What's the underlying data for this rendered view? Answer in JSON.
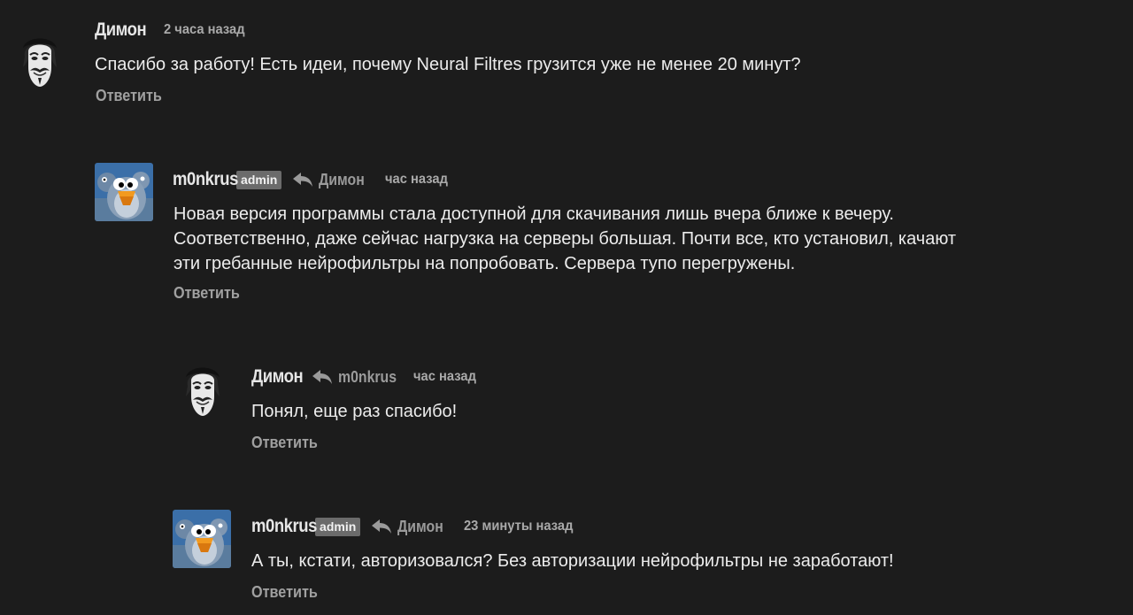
{
  "colors": {
    "background": "#1c1c1c",
    "text": "#ececec",
    "muted": "#a0a0a0",
    "badge_bg": "#6b6b6b"
  },
  "comments": [
    {
      "author": "Димон",
      "avatar_icon": "guy-fawkes-mask-avatar",
      "time": "2 часа назад",
      "text": "Спасибо за работу! Есть идеи, почему Neural Filtres грузится уже не менее 20 минут?",
      "reply_label": "Ответить"
    },
    {
      "author": "m0nkrus",
      "badge": "admin",
      "avatar_icon": "bird-avatar",
      "reply_to": "Димон",
      "time": "час назад",
      "text_lines": [
        "Новая версия программы стала доступной для скачивания лишь вчера ближе к вечеру.",
        "Соответственно, даже сейчас нагрузка на серверы большая. Почти все, кто установил, качают",
        "эти гребанные нейрофильтры на попробовать. Сервера тупо перегружены."
      ],
      "reply_label": "Ответить"
    },
    {
      "author": "Димон",
      "avatar_icon": "guy-fawkes-mask-avatar",
      "reply_to": "m0nkrus",
      "time": "час назад",
      "text": "Понял, еще раз спасибо!",
      "reply_label": "Ответить"
    },
    {
      "author": "m0nkrus",
      "badge": "admin",
      "avatar_icon": "bird-avatar",
      "reply_to": "Димон",
      "time": "23 минуты назад",
      "text": "А ты, кстати, авторизовался? Без авторизации нейрофильтры не заработают!",
      "reply_label": "Ответить"
    }
  ]
}
